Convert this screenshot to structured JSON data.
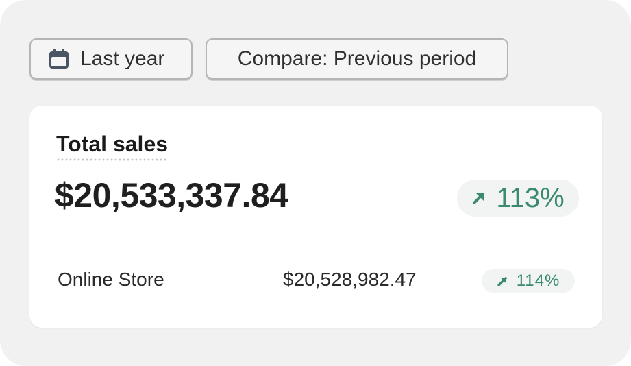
{
  "filters": {
    "date_label": "Last year",
    "date_icon": "calendar-icon",
    "compare_label": "Compare: Previous period"
  },
  "card": {
    "title": "Total sales",
    "total_value": "$20,533,337.84",
    "total_change": "113%",
    "total_change_direction": "up",
    "breakdown": [
      {
        "label": "Online Store",
        "value": "$20,528,982.47",
        "change": "114%",
        "change_direction": "up"
      }
    ]
  },
  "colors": {
    "positive": "#3b8a6e",
    "icon": "#4a5563"
  }
}
